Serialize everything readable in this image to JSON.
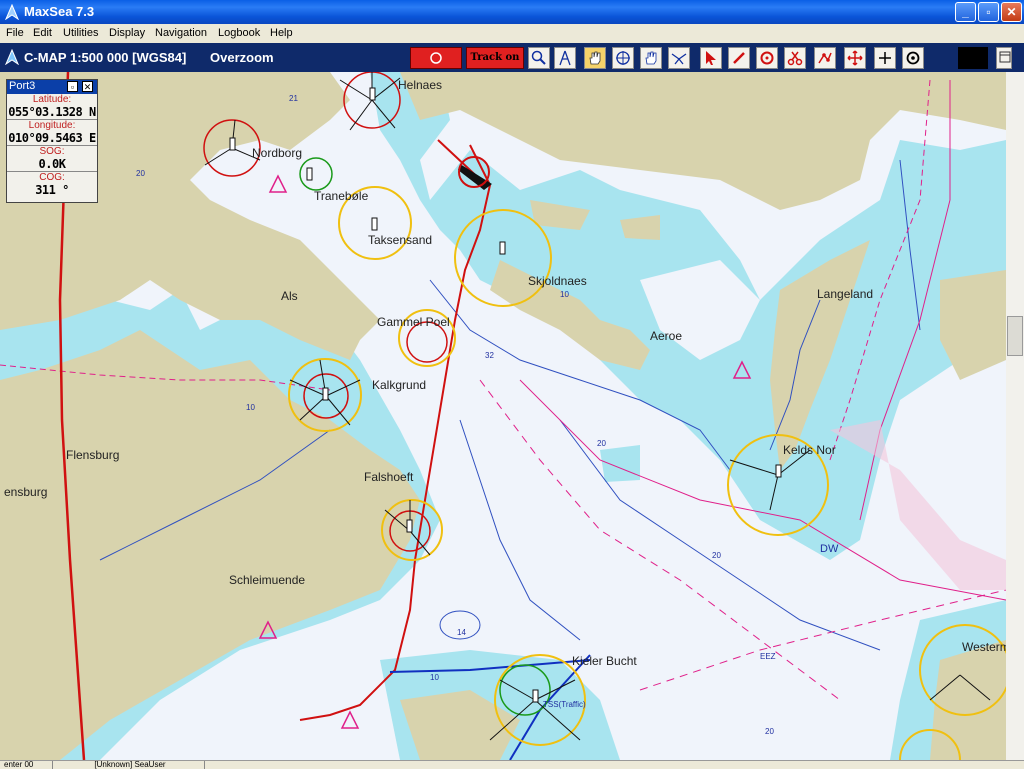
{
  "window": {
    "title": "MaxSea 7.3",
    "minimize": "_",
    "maximize": "▫",
    "close": "✕"
  },
  "menu": [
    "File",
    "Edit",
    "Utilities",
    "Display",
    "Navigation",
    "Logbook",
    "Help"
  ],
  "chart_header": {
    "info": "C-MAP  1:500 000 [WGS84]",
    "zoom_state": "Overzoom"
  },
  "toolbar": {
    "track_label": "Track on",
    "buttons": [
      "zoom-icon",
      "compass-icon",
      "hand-icon",
      "target-icon",
      "grab-icon",
      "route-icon",
      "cursor-icon",
      "pencil-icon",
      "rotate-icon",
      "scissors-icon",
      "waypoints-icon",
      "move-icon",
      "crosshair-icon",
      "circle-target-icon"
    ]
  },
  "nav_panel": {
    "title": "Port3",
    "latitude_label": "Latitude:",
    "latitude": "055°03.1328 N",
    "longitude_label": "Longitude:",
    "longitude": "010°09.5463 E",
    "sog_label": "SOG:",
    "sog": "0.0K",
    "cog_label": "COG:",
    "cog": "311 °"
  },
  "map_labels": {
    "helnaes": "Helnaes",
    "nordborg": "Nordborg",
    "taarsboel": "Tranebøle",
    "taksensand": "Taksensand",
    "als": "Als",
    "skjoldnaes": "Skjoldnaes",
    "langeland": "Langeland",
    "gammel_poel": "Gammel Poel",
    "aeroe": "Aeroe",
    "kalkgrund": "Kalkgrund",
    "flensburg": "Flensburg",
    "flensburg_w": "ensburg",
    "falshoeft": "Falshoeft",
    "kelds_nor": "Kelds Nor",
    "schleimuende": "Schleimuende",
    "kieler_bucht": "Kieler Bucht",
    "westerm": "Westerm",
    "traffic": "TSS(Traffic)",
    "eez": "EEZ",
    "dw": "DW"
  },
  "depths": [
    "21",
    "20",
    "10",
    "32",
    "20",
    "14",
    "20",
    "10",
    "20",
    "10"
  ],
  "statusbar": [
    "enter 00",
    "[Unknown] SeaUser"
  ],
  "colors": {
    "land": "#d8d3ad",
    "shallow": "#a8e4ef",
    "deep": "#f0f4fb",
    "track": "#d01010",
    "contour": "#3050c0",
    "boundary": "#e0208a"
  }
}
